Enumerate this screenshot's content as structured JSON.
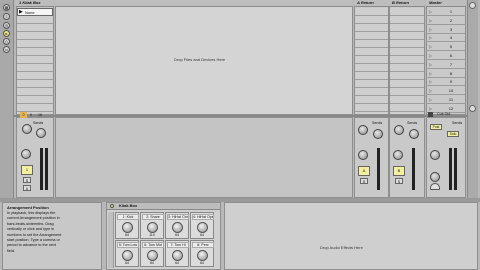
{
  "session": {
    "track1": {
      "name": "1 Kiiak Box",
      "clip": "None"
    },
    "return_a": {
      "name": "A Return"
    },
    "return_b": {
      "name": "B Return"
    },
    "master": {
      "name": "Master",
      "scenes": [
        "1",
        "2",
        "3",
        "4",
        "5",
        "6",
        "7",
        "8",
        "9",
        "10",
        "11",
        "12"
      ]
    },
    "drop_files_msg": "Drop Files and Devices Here"
  },
  "mixer": {
    "sends_label": "Sends",
    "track_number": "1",
    "solo": "S",
    "arm": "0",
    "return_a_button": "A",
    "return_b_button": "B",
    "cue_out": "Cue Out",
    "master_out": "Master",
    "post_label": "Post",
    "solo_label": "Solo",
    "track_io_values": [
      "0",
      "0",
      "16"
    ]
  },
  "info_view": {
    "title": "Arrangement Position",
    "body": "In playback, this displays the current Arrangement position in bars-beats-sixteenths. Drag vertically or click and type in numbers to set the Arrangement start position. Type a comma or period to advance to the next field."
  },
  "device": {
    "title": "Kiiak Box",
    "pads": [
      {
        "label": "1: Kick",
        "value": "64"
      },
      {
        "label": "2: Snare",
        "value": "110"
      },
      {
        "label": "3: HiHat Closed",
        "value": "64"
      },
      {
        "label": "4: HiHat Open",
        "value": "64"
      },
      {
        "label": "5: Tom Low",
        "value": "64"
      },
      {
        "label": "6: Tom Mid",
        "value": "64"
      },
      {
        "label": "7: Tom Hi",
        "value": "64"
      },
      {
        "label": "8: Perc",
        "value": "64"
      }
    ],
    "drop_effects_msg": "Drop Audio Effects Here"
  }
}
